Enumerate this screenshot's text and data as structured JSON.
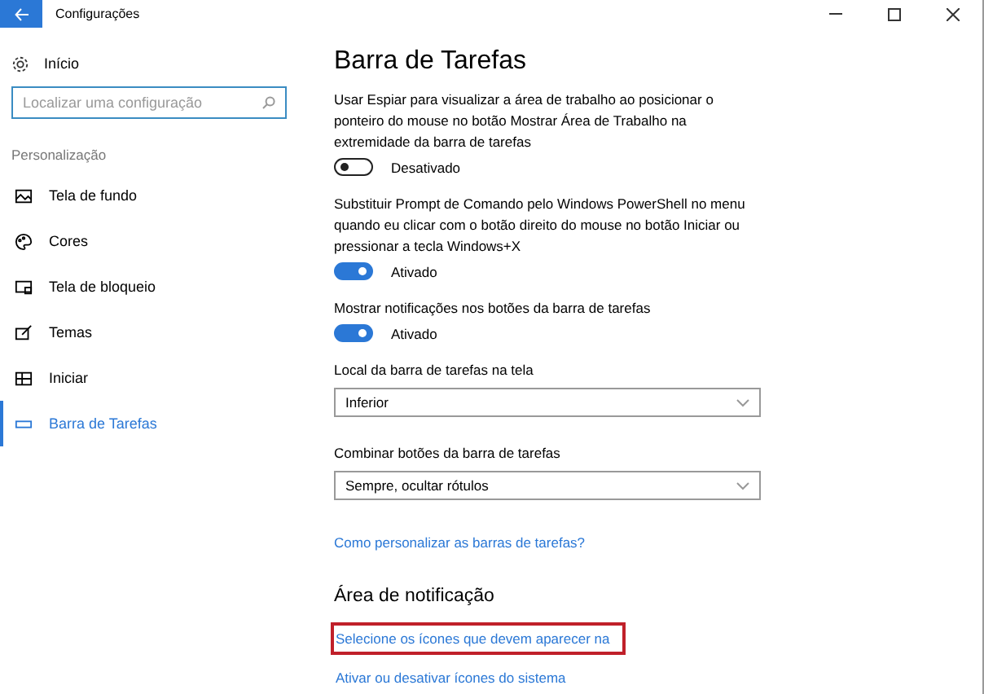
{
  "window": {
    "title": "Configurações"
  },
  "sidebar": {
    "home": "Início",
    "search": {
      "placeholder": "Localizar uma configuração"
    },
    "section": "Personalização",
    "items": [
      {
        "label": "Tela de fundo",
        "selected": false
      },
      {
        "label": "Cores",
        "selected": false
      },
      {
        "label": "Tela de bloqueio",
        "selected": false
      },
      {
        "label": "Temas",
        "selected": false
      },
      {
        "label": "Iniciar",
        "selected": false
      },
      {
        "label": "Barra de Tarefas",
        "selected": true
      }
    ]
  },
  "content": {
    "title": "Barra de Tarefas",
    "settings": [
      {
        "kind": "toggle",
        "label": "Usar Espiar para visualizar a área de trabalho ao posicionar o ponteiro do mouse no botão Mostrar Área de Trabalho na extremidade da barra de tarefas",
        "on": false,
        "state": "Desativado"
      },
      {
        "kind": "toggle",
        "label": "Substituir Prompt de Comando pelo Windows PowerShell no menu quando eu clicar com o botão direito do mouse no botão Iniciar ou pressionar a tecla Windows+X",
        "on": true,
        "state": "Ativado"
      },
      {
        "kind": "toggle",
        "label": "Mostrar notificações nos botões da barra de tarefas",
        "on": true,
        "state": "Ativado"
      },
      {
        "kind": "dropdown",
        "label": "Local da barra de tarefas na tela",
        "value": "Inferior"
      },
      {
        "kind": "dropdown",
        "label": "Combinar botões da barra de tarefas",
        "value": "Sempre, ocultar rótulos"
      },
      {
        "kind": "link",
        "label": "Como personalizar as barras de tarefas?"
      }
    ],
    "section": "Área de notificação",
    "links": [
      {
        "label": "Selecione os ícones que devem aparecer na",
        "highlighted": true
      },
      {
        "label": "Ativar ou desativar ícones do sistema",
        "highlighted": false
      }
    ]
  }
}
